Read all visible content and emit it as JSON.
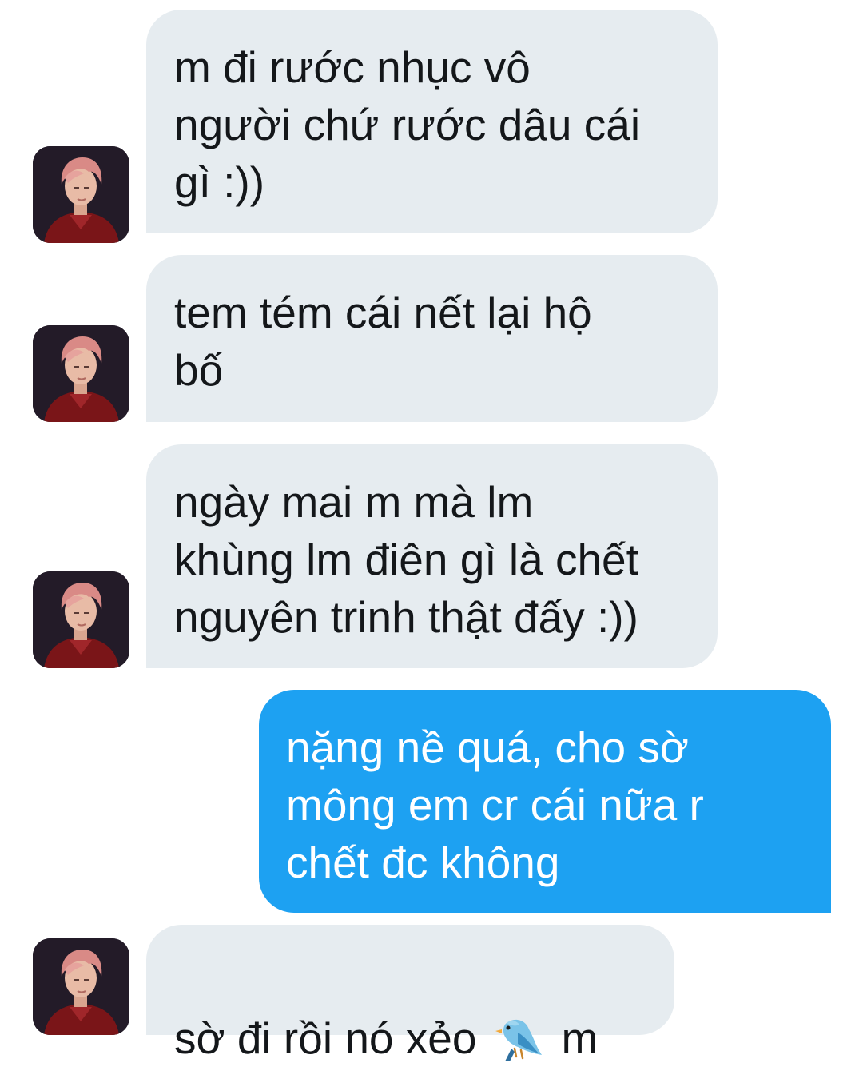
{
  "conversation": {
    "messages": [
      {
        "sender": "them",
        "text": "m đi rước nhục vô\nngười chứ rước dâu cái\ngì :))"
      },
      {
        "sender": "them",
        "text": "tem tém cái nết lại hộ\nbố"
      },
      {
        "sender": "them",
        "text": "ngày mai m mà lm\nkhùng lm điên gì là chết\nnguyên trinh thật đấy :))"
      },
      {
        "sender": "me",
        "text": "nặng nề quá, cho sờ\nmông em cr cái nữa r\nchết đc không"
      },
      {
        "sender": "them",
        "text_before_icon": "sờ đi rồi nó xẻo",
        "icon": "blue-bird-emoji",
        "text_after_icon": "m"
      }
    ]
  },
  "colors": {
    "incoming_bubble": "#e6ecf0",
    "outgoing_bubble": "#1da1f2",
    "incoming_text": "#14171a",
    "outgoing_text": "#ffffff",
    "background": "#ffffff"
  }
}
